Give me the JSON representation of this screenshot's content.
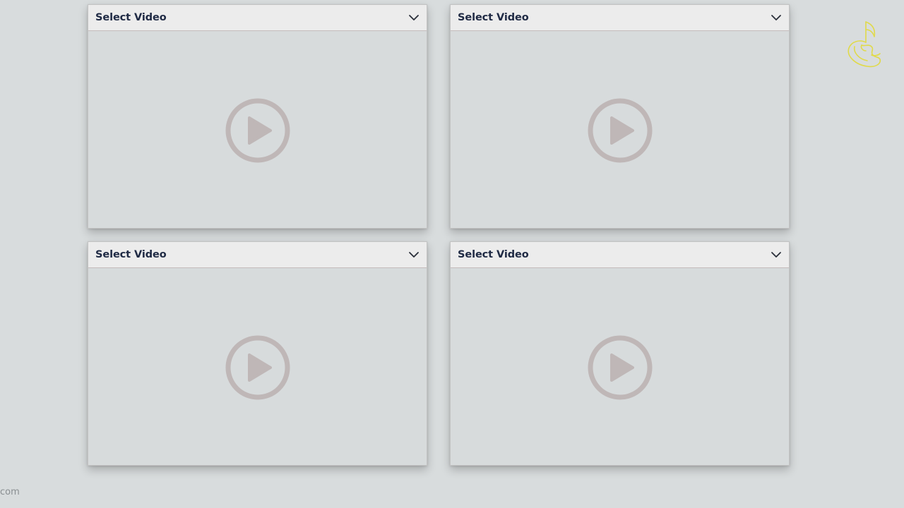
{
  "panels": [
    {
      "title": "Select Video"
    },
    {
      "title": "Select Video"
    },
    {
      "title": "Select Video"
    },
    {
      "title": "Select Video"
    }
  ],
  "icons": {
    "dropdown": "chevron-down-icon",
    "play": "play-circle-icon",
    "logo": "music-note-logo"
  },
  "colors": {
    "background": "#d8dcdd",
    "header": "#ececec",
    "title": "#1f2a44",
    "play_icon": "#bfb7b7",
    "logo": "#e0da4a"
  },
  "footer": {
    "partial_text": "com"
  }
}
